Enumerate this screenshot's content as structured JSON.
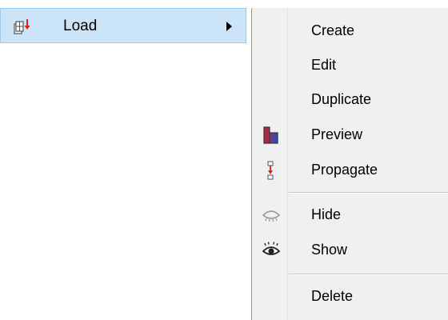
{
  "parent_menu": {
    "label": "Load",
    "icon": "load-icon"
  },
  "submenu": {
    "items": [
      {
        "label": "Create",
        "icon": ""
      },
      {
        "label": "Edit",
        "icon": ""
      },
      {
        "label": "Duplicate",
        "icon": ""
      },
      {
        "label": "Preview",
        "icon": "preview-icon"
      },
      {
        "label": "Propagate",
        "icon": "propagate-icon"
      },
      {
        "label": "Hide",
        "icon": "hide-eye-closed-icon"
      },
      {
        "label": "Show",
        "icon": "show-eye-icon"
      },
      {
        "label": "Delete",
        "icon": ""
      }
    ]
  },
  "colors": {
    "highlight_bg": "#cce4f7",
    "highlight_border": "#99c9ef",
    "menu_bg": "#f0f0f0",
    "icon_red": "#e02020",
    "icon_blue": "#2050d0"
  }
}
